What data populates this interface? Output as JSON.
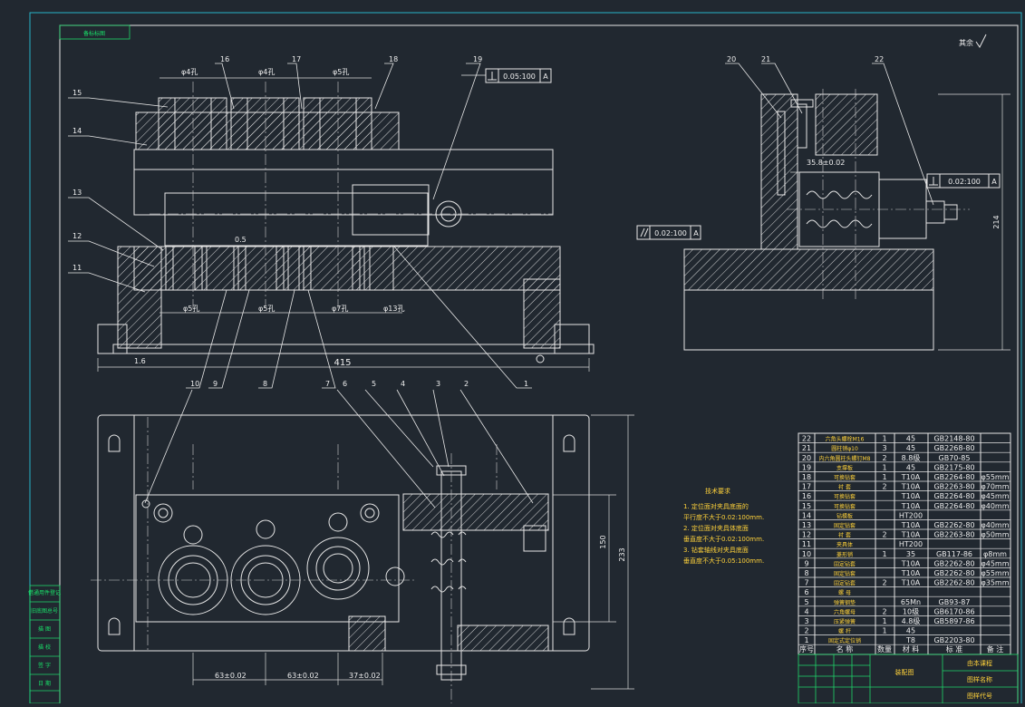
{
  "header": {
    "corner_tag": "备标标图",
    "roughness": "其余"
  },
  "left_strip": [
    "借通用件登记",
    "旧底图总号",
    "描  图",
    "描  校",
    "签  字",
    "日  期"
  ],
  "part_numbers": [
    "1",
    "2",
    "3",
    "4",
    "5",
    "6",
    "7",
    "8",
    "9",
    "10",
    "11",
    "12",
    "13",
    "14",
    "15",
    "16",
    "17",
    "18",
    "19",
    "20",
    "21",
    "22"
  ],
  "dims": {
    "top_phi_1": "φ4孔",
    "top_phi_2": "φ4孔",
    "top_phi_3": "φ5孔",
    "bot_phi_1": "φ5孔",
    "bot_phi_2": "φ5孔",
    "bot_phi_3": "φ7孔",
    "bot_phi_4": "φ13孔",
    "clearance": "0.5",
    "length_415": "415",
    "val_1_6": "1.6",
    "perp_tol": "0.05:100",
    "perp_ref": "A",
    "side_perp_tol": "0.02:100",
    "side_perp_ref": "A",
    "par_tol": "0.02:100",
    "par_ref": "A",
    "offset_35": "35.8±0.02",
    "height_214": "214",
    "plan_150": "150",
    "plan_233": "233",
    "pitch_1": "63±0.02",
    "pitch_2": "63±0.02",
    "pitch_3": "37±0.02"
  },
  "tech_req": {
    "title": "技术要求",
    "items": [
      "1. 定位面对夹具底面的",
      "   平行度不大于0.02:100mm.",
      "2. 定位面对夹具体底面",
      "   垂直度不大于0.02:100mm.",
      "3. 钻套轴线对夹具底面",
      "   垂直度不大于0.05:100mm."
    ]
  },
  "bom": {
    "headers": [
      "序号",
      "名    称",
      "数量",
      "材  料",
      "标  准",
      "备  注"
    ],
    "rows": [
      [
        "22",
        "六角头螺栓M16",
        "1",
        "45",
        "GB2148-80",
        ""
      ],
      [
        "21",
        "圆柱销φ10",
        "3",
        "45",
        "GB2268-80",
        ""
      ],
      [
        "20",
        "内六角圆柱头螺钉M8",
        "2",
        "8.8级",
        "GB70-85",
        ""
      ],
      [
        "19",
        "支撑板",
        "1",
        "45",
        "GB2175-80",
        ""
      ],
      [
        "18",
        "可换钻套",
        "1",
        "T10A",
        "GB2264-80",
        "φ55mm"
      ],
      [
        "17",
        "衬  套",
        "2",
        "T10A",
        "GB2263-80",
        "φ70mm"
      ],
      [
        "16",
        "可换钻套",
        "",
        "T10A",
        "GB2264-80",
        "φ45mm"
      ],
      [
        "15",
        "可换钻套",
        "",
        "T10A",
        "GB2264-80",
        "φ40mm"
      ],
      [
        "14",
        "钻模板",
        "",
        "HT200",
        "",
        ""
      ],
      [
        "13",
        "固定钻套",
        "",
        "T10A",
        "GB2262-80",
        "φ40mm"
      ],
      [
        "12",
        "衬  套",
        "2",
        "T10A",
        "GB2263-80",
        "φ50mm"
      ],
      [
        "11",
        "夹具体",
        "",
        "HT200",
        "",
        ""
      ],
      [
        "10",
        "菱形销",
        "1",
        "35",
        "GB117-86",
        "φ8mm"
      ],
      [
        "9",
        "固定钻套",
        "",
        "T10A",
        "GB2262-80",
        "φ45mm"
      ],
      [
        "8",
        "固定钻套",
        "",
        "T10A",
        "GB2262-80",
        "φ55mm"
      ],
      [
        "7",
        "固定钻套",
        "2",
        "T10A",
        "GB2262-80",
        "φ35mm"
      ],
      [
        "6",
        "螺  母",
        "",
        "",
        "",
        ""
      ],
      [
        "5",
        "弹簧钢垫",
        "",
        "65Mn",
        "GB93-87",
        ""
      ],
      [
        "4",
        "六角螺母",
        "2",
        "10级",
        "GB6170-86",
        ""
      ],
      [
        "3",
        "压紧弹簧",
        "1",
        "4.8级",
        "GB5897-86",
        ""
      ],
      [
        "2",
        "螺  杆",
        "1",
        "45",
        "",
        ""
      ],
      [
        "1",
        "固定式定位销",
        "",
        "T8",
        "GB2203-80",
        ""
      ]
    ]
  },
  "title_block": {
    "drawing_name": "装配图",
    "school": "由本课程",
    "project": "图样名称",
    "code": "图样代号"
  },
  "colors": {
    "background": "#212830",
    "line": "#e6e6e6",
    "frame": "#27b3c8",
    "label_green": "#19e36a"
  }
}
